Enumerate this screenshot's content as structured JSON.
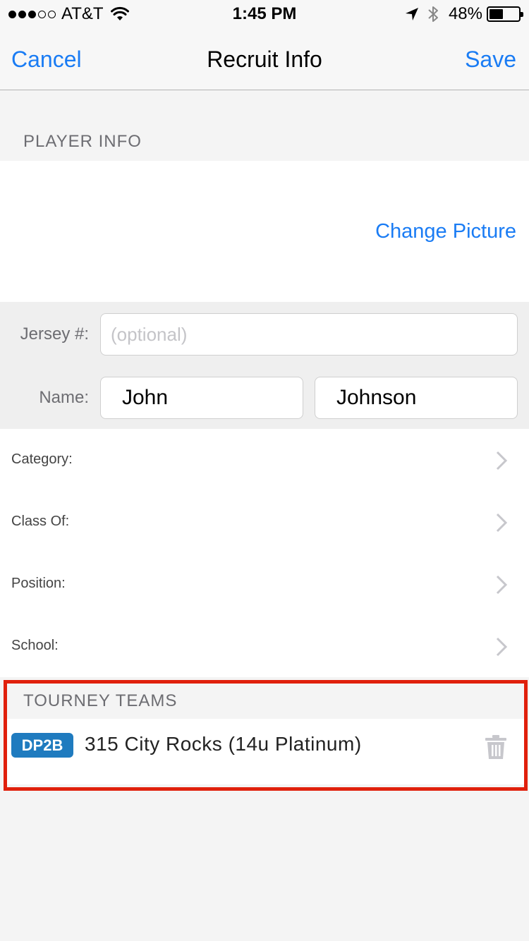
{
  "status_bar": {
    "carrier": "AT&T",
    "time": "1:45 PM",
    "battery_percent": "48%",
    "battery_level": 0.48,
    "signal_bars_filled": 3,
    "signal_bars_total": 5
  },
  "nav": {
    "cancel_label": "Cancel",
    "title": "Recruit Info",
    "save_label": "Save"
  },
  "player_info": {
    "header": "PLAYER INFO",
    "change_picture_label": "Change Picture",
    "jersey_label": "Jersey #:",
    "jersey_placeholder": "(optional)",
    "jersey_value": "",
    "name_label": "Name:",
    "first_name": "John",
    "last_name": "Johnson"
  },
  "details": {
    "rows": [
      {
        "label": "Category:"
      },
      {
        "label": "Class Of:"
      },
      {
        "label": "Position:"
      },
      {
        "label": "School:"
      }
    ]
  },
  "tourney_teams": {
    "header": "TOURNEY TEAMS",
    "teams": [
      {
        "badge": "DP2B",
        "name": "315 City Rocks (14u Platinum)"
      }
    ]
  },
  "colors": {
    "accent": "#1a7cf4",
    "badge": "#1f7bbf",
    "highlight_outline": "#e0200c"
  },
  "icons": {
    "wifi": "wifi-icon",
    "location": "location-arrow-icon",
    "bluetooth": "bluetooth-icon",
    "chevron": "chevron-right-icon",
    "trash": "trash-icon"
  }
}
